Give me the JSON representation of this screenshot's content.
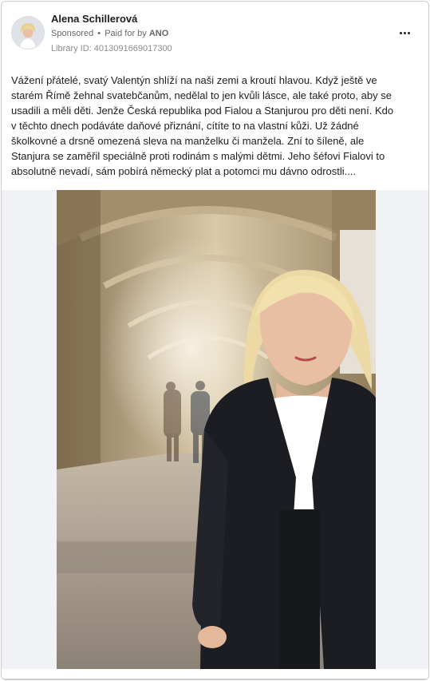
{
  "ad": {
    "advertiser_name": "Alena Schillerová",
    "sponsored_label": "Sponsored",
    "separator": "•",
    "paid_for_label": "Paid for by",
    "payer": "ANO",
    "library_id": "Library ID: 4013091669017300",
    "body": "Vážení přátelé, svatý Valentýn shlíží na naši zemi a kroutí hlavou. Když ještě ve\nstarém Římě žehnal svatebčanům, nedělal to jen kvůli lásce, ale také proto, aby se\nusadili a měli děti. Jenže Česká republika pod Fialou a Stanjurou pro děti není. Kdo\nv těchto dnech podáváte daňové přiznání, cítíte to na vlastní kůži. Už žádné\nškolkovné a drsně omezená sleva na manželku či manžela. Zní to šíleně, ale\nStanjura se zaměřil speciálně proti rodinám s malými dětmi. Jeho šéfovi Fialovi to\nabsolutně nevadí, sám pobírá německý plat a potomci mu dávno odrostli...."
  },
  "icons": {
    "avatar": "profile-avatar",
    "more": "more-options-icon",
    "photo": "ad-photo"
  },
  "colors": {
    "name_text": "#1c1e21",
    "meta_text": "#65676b",
    "border": "#c9ccd1",
    "media_background": "#f0f2f5"
  }
}
